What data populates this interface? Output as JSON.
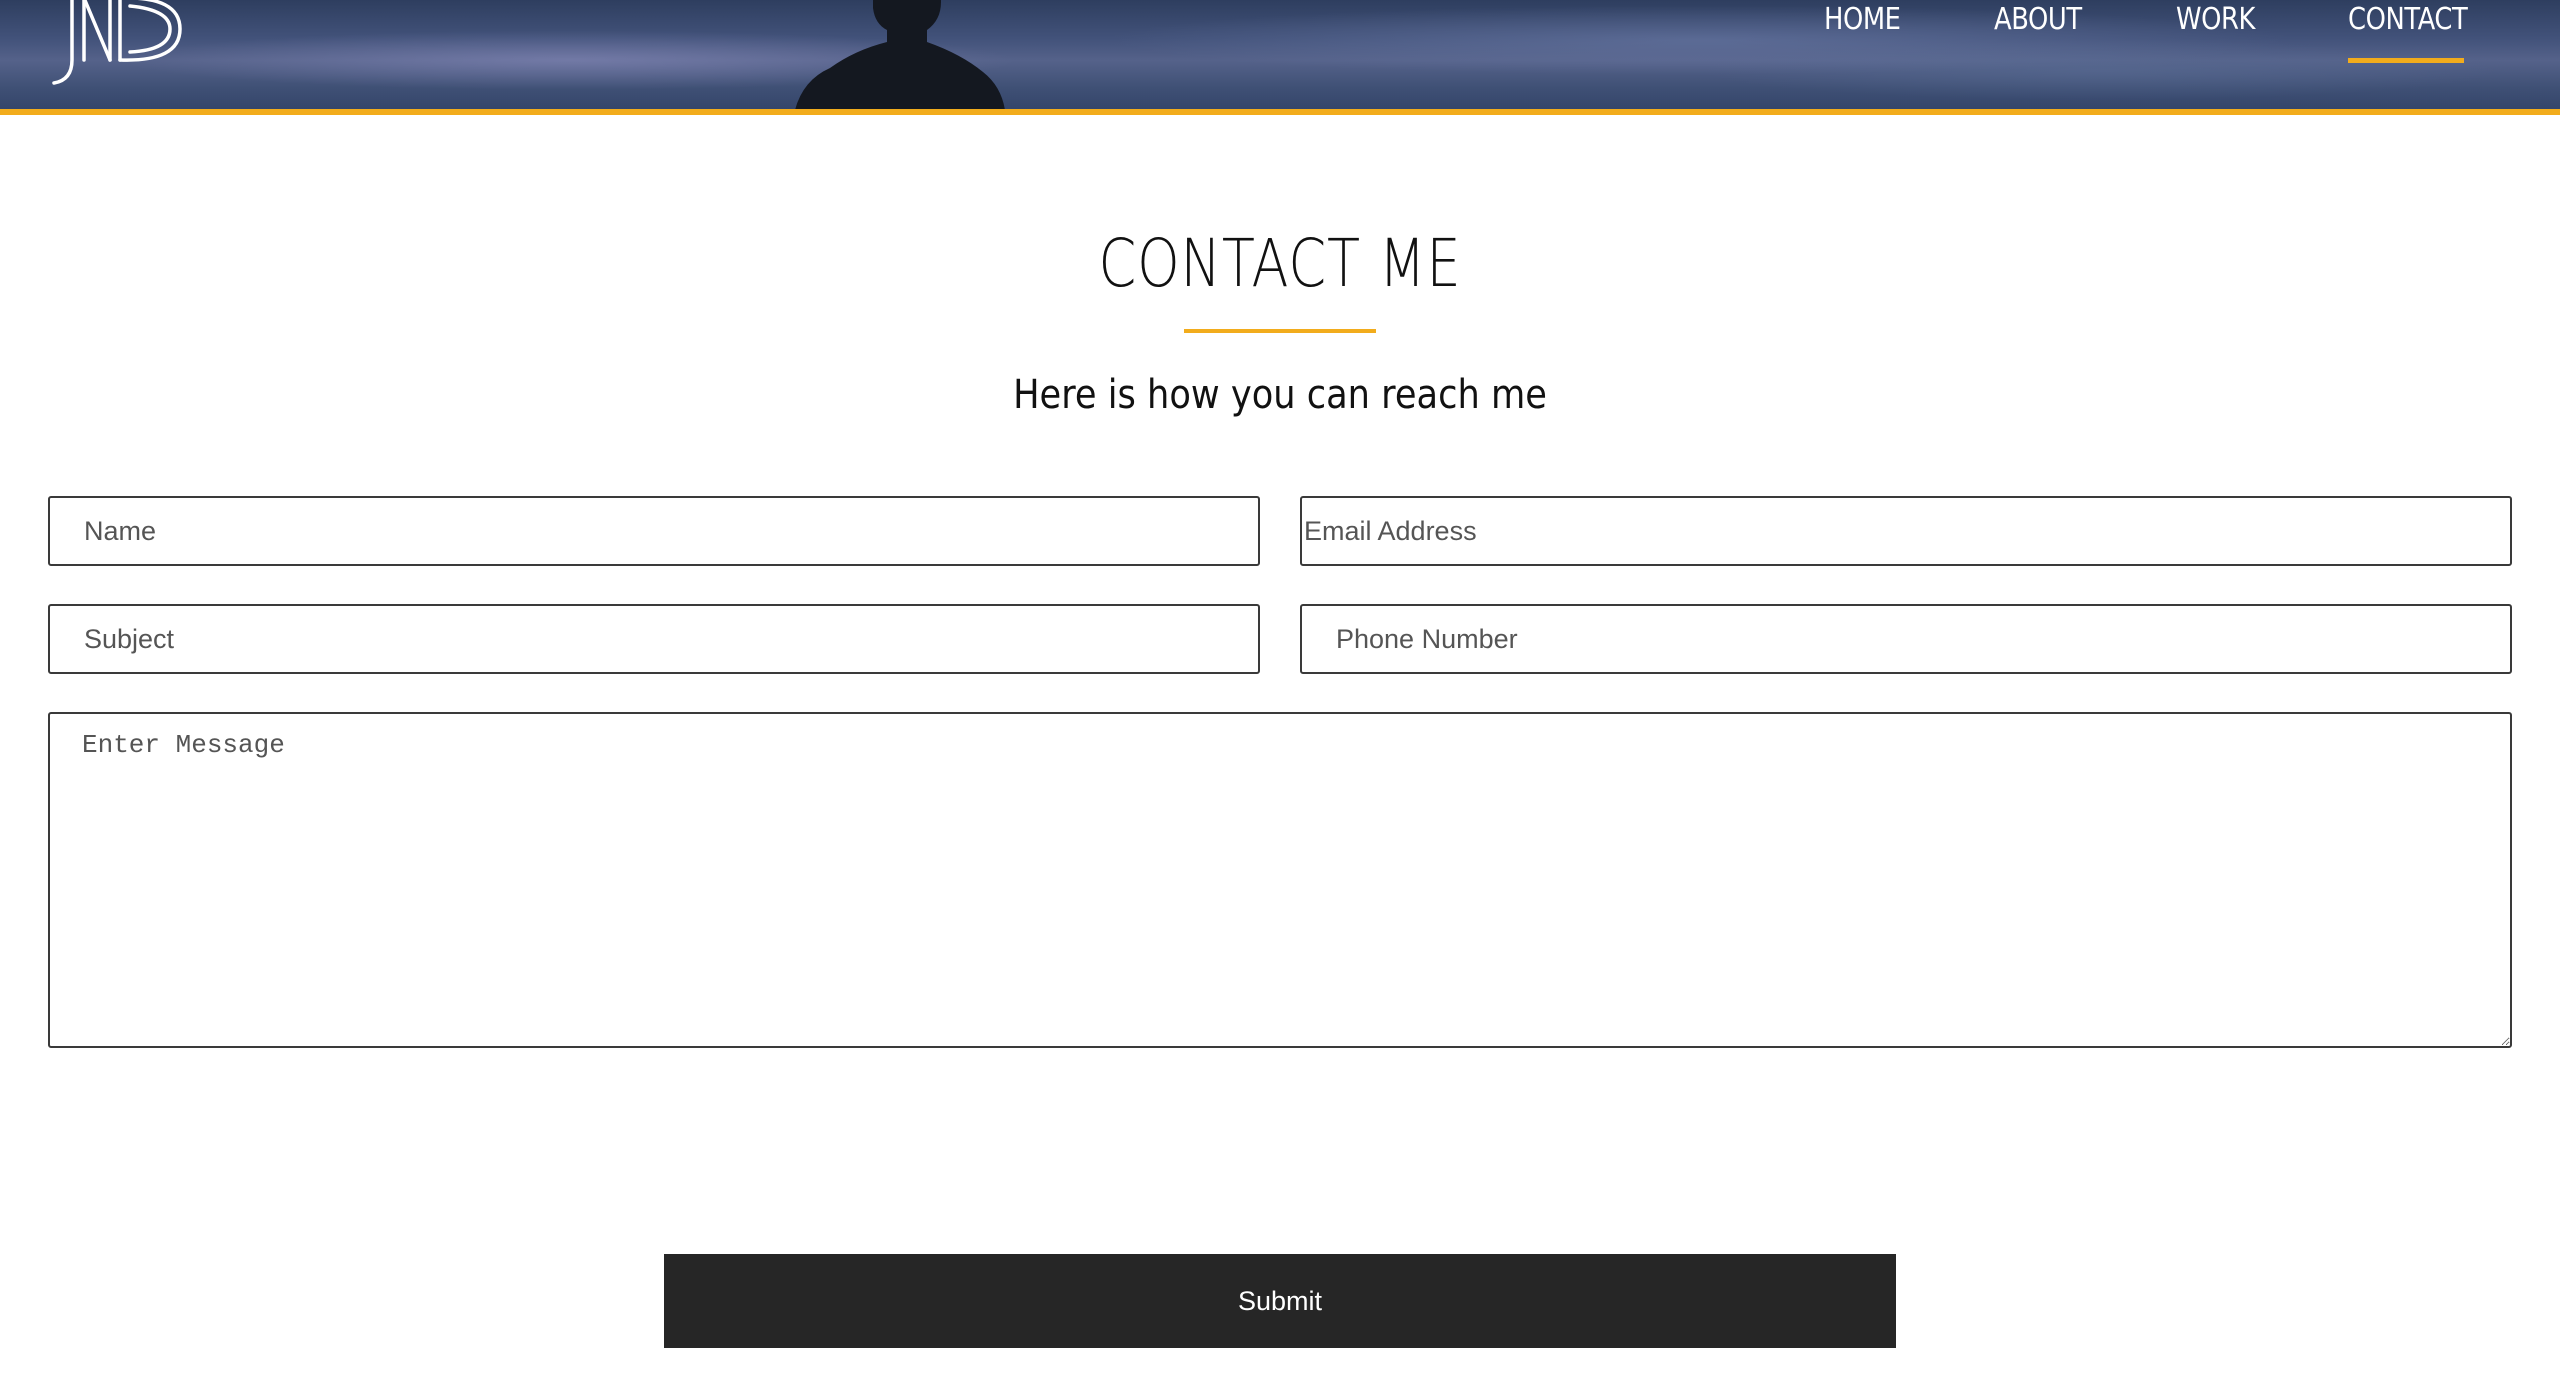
{
  "brand": {
    "logo_text": "JND",
    "accent_color": "#f2ac1c"
  },
  "nav": {
    "items": [
      {
        "label": "HOME"
      },
      {
        "label": "ABOUT"
      },
      {
        "label": "WORK"
      },
      {
        "label": "CONTACT",
        "active": true
      }
    ]
  },
  "main": {
    "title": "CONTACT ME",
    "subtitle": "Here is how you can reach me"
  },
  "form": {
    "name_placeholder": "Name",
    "email_placeholder": "Email Address",
    "subject_placeholder": "Subject",
    "phone_placeholder": "Phone Number",
    "message_placeholder": "Enter Message",
    "submit_label": "Submit"
  }
}
